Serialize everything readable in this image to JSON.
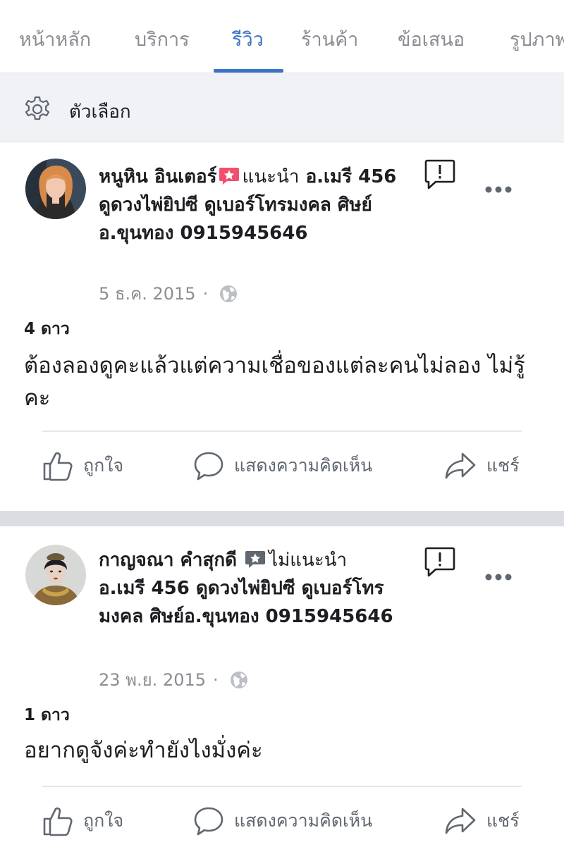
{
  "tabs": [
    {
      "label": "หน้าหลัก"
    },
    {
      "label": "บริการ"
    },
    {
      "label": "รีวิว"
    },
    {
      "label": "ร้านค้า"
    },
    {
      "label": "ข้อเสนอ"
    },
    {
      "label": "รูปภาพ"
    }
  ],
  "active_tab": "รีวิว",
  "options": {
    "label": "ตัวเลือก"
  },
  "reviews": [
    {
      "author": "หนูหิน อินเตอร์",
      "recommendation": "แนะนำ",
      "page_name": "อ.เมรี 456 ดูดวงไพ่ยิปซี ดูเบอร์โทรมงคล ศิษย์อ.ขุนทอง 0915945646",
      "date": "5 ธ.ค. 2015",
      "separator": "·",
      "stars": "4 ดาว",
      "text": "ต้องลองดูคะแล้วแต่ความเชื่อของแต่ละคนไม่ลอง ไม่รู้คะ",
      "actions": {
        "like": "ถูกใจ",
        "comment": "แสดงความคิดเห็น",
        "share": "แชร์"
      }
    },
    {
      "author": "กาญจณา คำสุกดี",
      "recommendation": "ไม่แนะนำ",
      "page_name": "อ.เมรี 456 ดูดวงไพ่ยิปซี ดูเบอร์โทรมงคล ศิษย์อ.ขุนทอง 0915945646",
      "date": "23 พ.ย. 2015",
      "separator": "·",
      "stars": "1 ดาว",
      "text": "อยากดูจังค่ะทำยังไงมั่งค่ะ",
      "actions": {
        "like": "ถูกใจ",
        "comment": "แสดงความคิดเห็น",
        "share": "แชร์"
      }
    }
  ],
  "colors": {
    "accent": "#3b72c6",
    "recommend_badge": "#f0506e",
    "not_recommend_badge": "#606770",
    "muted_text": "#8a8d91"
  },
  "icons": [
    "gear-icon",
    "recommend-badge-icon",
    "not-recommend-badge-icon",
    "globe-icon",
    "report-icon",
    "more-options-icon",
    "like-icon",
    "comment-icon",
    "share-icon"
  ]
}
